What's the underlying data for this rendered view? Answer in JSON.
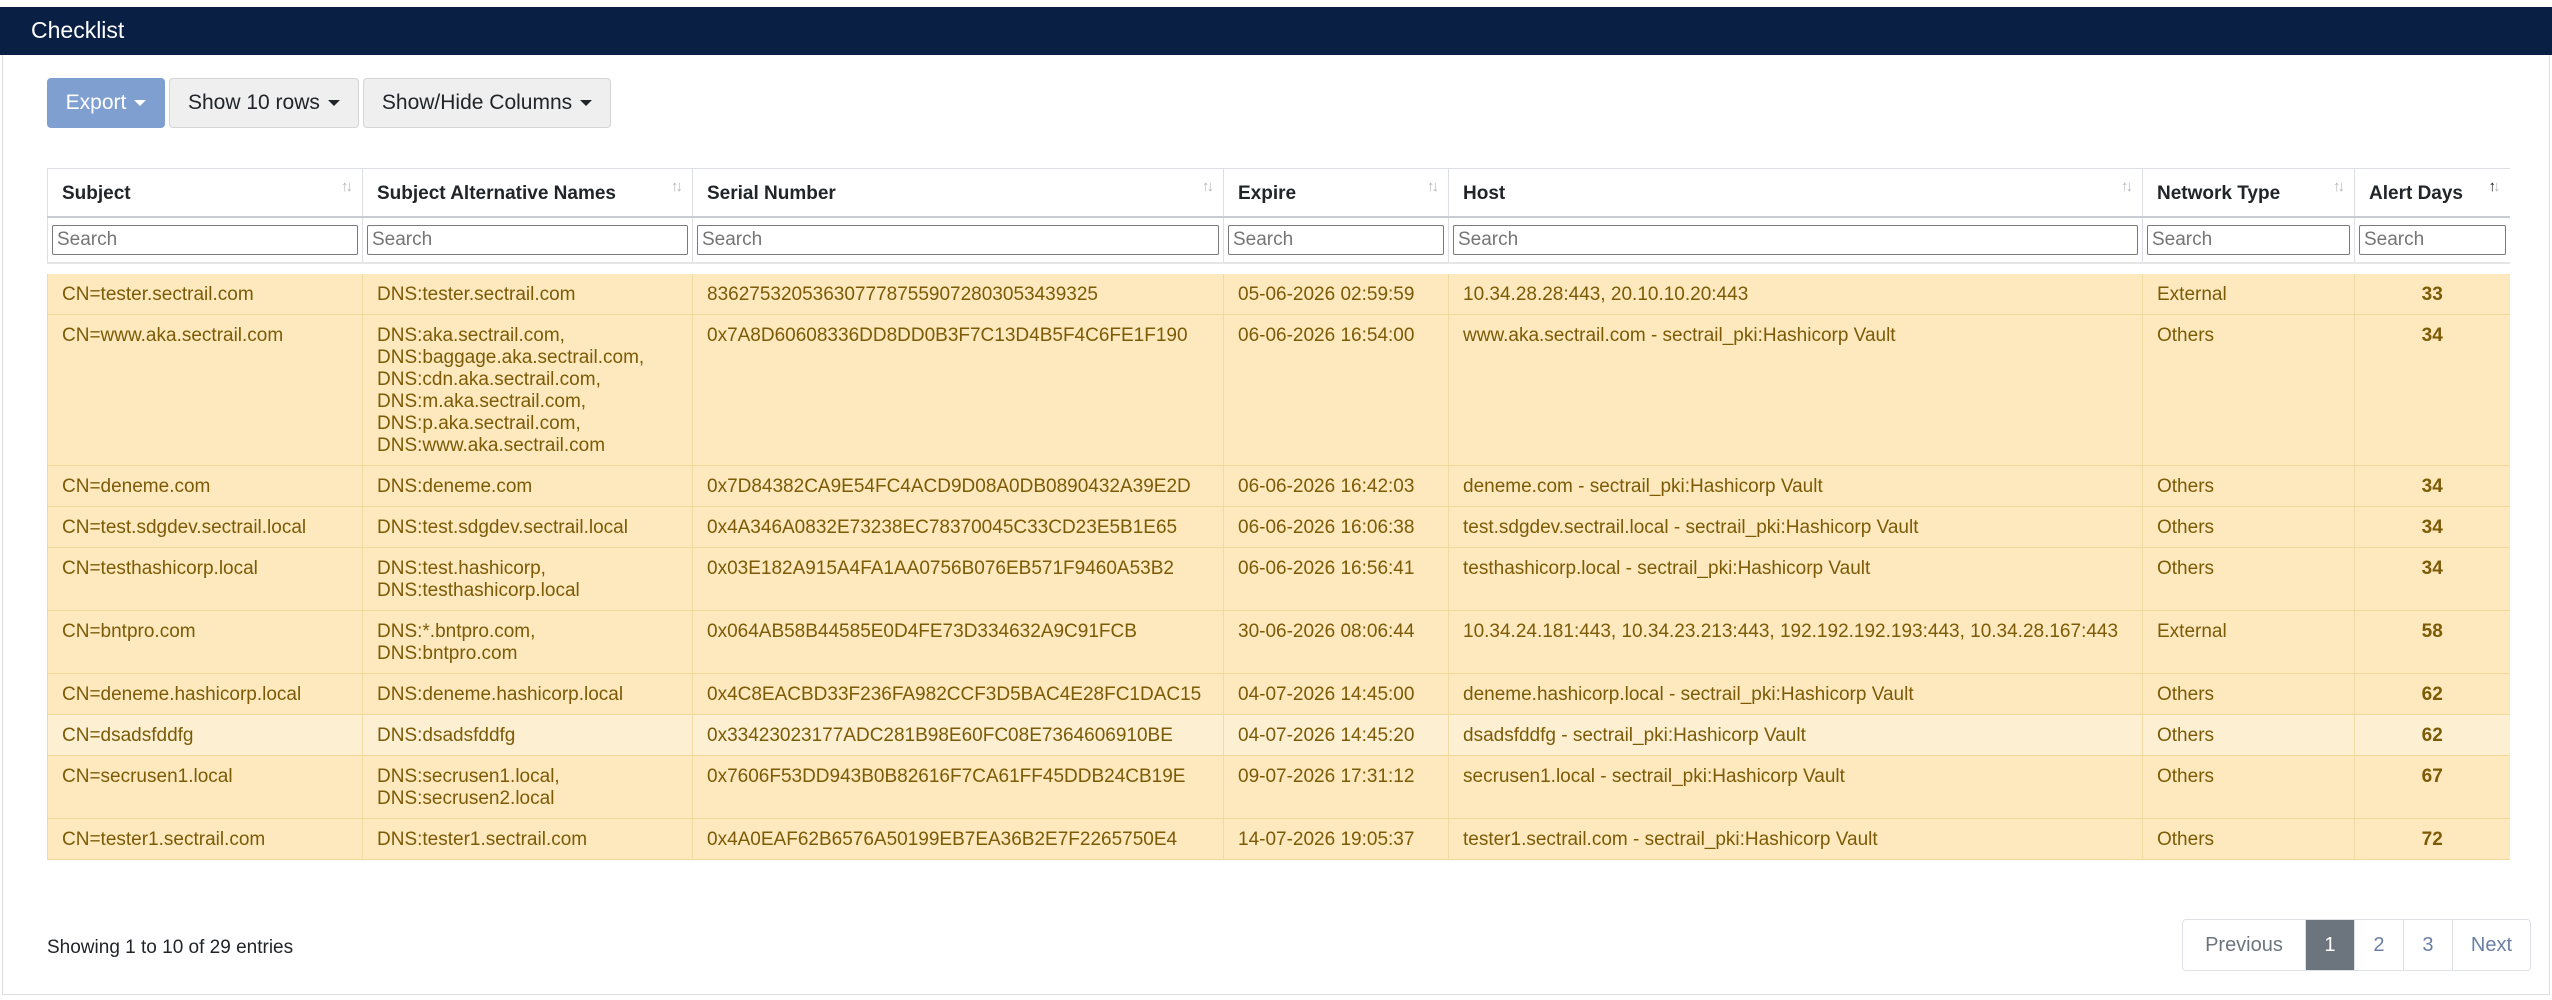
{
  "header": {
    "title": "Checklist"
  },
  "toolbar": {
    "export_label": "Export",
    "rows_label": "Show 10 rows",
    "columns_label": "Show/Hide Columns"
  },
  "table": {
    "columns": [
      "Subject",
      "Subject Alternative Names",
      "Serial Number",
      "Expire",
      "Host",
      "Network Type",
      "Alert Days"
    ],
    "search_placeholder": "Search",
    "rows": [
      {
        "subject": "CN=tester.sectrail.com",
        "san": "DNS:tester.sectrail.com",
        "serial": "836275320536307778755907280305343932 5",
        "expire": "05-06-2026 02:59:59",
        "host": "10.34.28.28:443, 20.10.10.20:443",
        "network": "External",
        "alert": "33"
      },
      {
        "subject": "CN=www.aka.sectrail.com",
        "san": "DNS:aka.sectrail.com,\nDNS:baggage.aka.sectrail.com,\nDNS:cdn.aka.sectrail.com,\nDNS:m.aka.sectrail.com,\nDNS:p.aka.sectrail.com,\nDNS:www.aka.sectrail.com",
        "serial": "0x7A8D60608336DD8DD0B3F7C13D4B5F4C6FE1F190",
        "expire": "06-06-2026 16:54:00",
        "host": "www.aka.sectrail.com - sectrail_pki:Hashicorp Vault",
        "network": "Others",
        "alert": "34"
      },
      {
        "subject": "CN=deneme.com",
        "san": "DNS:deneme.com",
        "serial": "0x7D84382CA9E54FC4ACD9D08A0DB0890432A39E2D",
        "expire": "06-06-2026 16:42:03",
        "host": "deneme.com - sectrail_pki:Hashicorp Vault",
        "network": "Others",
        "alert": "34"
      },
      {
        "subject": "CN=test.sdgdev.sectrail.local",
        "san": "DNS:test.sdgdev.sectrail.local",
        "serial": "0x4A346A0832E73238EC78370045C33CD23E5B1E65",
        "expire": "06-06-2026 16:06:38",
        "host": "test.sdgdev.sectrail.local - sectrail_pki:Hashicorp Vault",
        "network": "Others",
        "alert": "34"
      },
      {
        "subject": "CN=testhashicorp.local",
        "san": "DNS:test.hashicorp,\nDNS:testhashicorp.local",
        "serial": "0x03E182A915A4FA1AA0756B076EB571F9460A53B2",
        "expire": "06-06-2026 16:56:41",
        "host": "testhashicorp.local - sectrail_pki:Hashicorp Vault",
        "network": "Others",
        "alert": "34"
      },
      {
        "subject": "CN=bntpro.com",
        "san": "DNS:*.bntpro.com,\nDNS:bntpro.com",
        "serial": "0x064AB58B44585E0D4FE73D334632A9C91FCB",
        "expire": "30-06-2026 08:06:44",
        "host": "10.34.24.181:443, 10.34.23.213:443, 192.192.192.193:443, 10.34.28.167:443",
        "network": "External",
        "alert": "58"
      },
      {
        "subject": "CN=deneme.hashicorp.local",
        "san": "DNS:deneme.hashicorp.local",
        "serial": "0x4C8EACBD33F236FA982CCF3D5BAC4E28FC1DAC15",
        "expire": "04-07-2026 14:45:00",
        "host": "deneme.hashicorp.local - sectrail_pki:Hashicorp Vault",
        "network": "Others",
        "alert": "62"
      },
      {
        "subject": "CN=dsadsfddfg",
        "san": "DNS:dsadsfddfg",
        "serial": "0x33423023177ADC281B98E60FC08E7364606910BE",
        "expire": "04-07-2026 14:45:20",
        "host": "dsadsfddfg - sectrail_pki:Hashicorp Vault",
        "network": "Others",
        "alert": "62"
      },
      {
        "subject": "CN=secrusen1.local",
        "san": "DNS:secrusen1.local,\nDNS:secrusen2.local",
        "serial": "0x7606F53DD943B0B82616F7CA61FF45DDB24CB19E",
        "expire": "09-07-2026 17:31:12",
        "host": "secrusen1.local - sectrail_pki:Hashicorp Vault",
        "network": "Others",
        "alert": "67"
      },
      {
        "subject": "CN=tester1.sectrail.com",
        "san": "DNS:tester1.sectrail.com",
        "serial": "0x4A0EAF62B6576A50199EB7EA36B2E7F2265750E4",
        "expire": "14-07-2026 19:05:37",
        "host": "tester1.sectrail.com - sectrail_pki:Hashicorp Vault",
        "network": "Others",
        "alert": "72"
      }
    ]
  },
  "footer": {
    "info": "Showing 1 to 10 of 29 entries"
  },
  "pagination": {
    "previous": "Previous",
    "pages": [
      "1",
      "2",
      "3"
    ],
    "active": "1",
    "next": "Next"
  },
  "colors": {
    "header_bg": "#0a1f44",
    "row_bg": "#fde9bd",
    "row_text": "#7c5a06",
    "export_btn": "#7f9fd0"
  }
}
